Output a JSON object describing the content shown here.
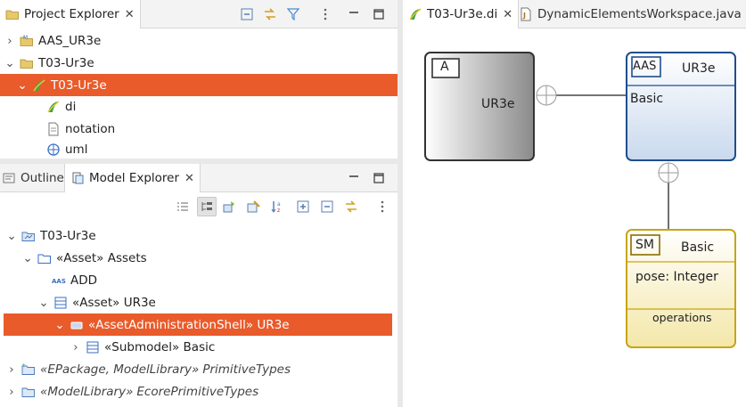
{
  "project_explorer": {
    "title": "Project Explorer",
    "items": [
      {
        "label": "AAS_UR3e"
      },
      {
        "label": "T03-Ur3e"
      },
      {
        "label": "T03-Ur3e"
      },
      {
        "label": "di"
      },
      {
        "label": "notation"
      },
      {
        "label": "uml"
      }
    ]
  },
  "bottom_tabs": {
    "outline": "Outline",
    "model_explorer": "Model Explorer"
  },
  "model_explorer": {
    "items": [
      {
        "label": "T03-Ur3e"
      },
      {
        "label": "«Asset» Assets"
      },
      {
        "label": "ADD"
      },
      {
        "label": "«Asset» UR3e"
      },
      {
        "label": "«AssetAdministrationShell» UR3e"
      },
      {
        "label": "«Submodel» Basic"
      },
      {
        "prefix": "«EPackage, ModelLibrary»",
        "label": "PrimitiveTypes"
      },
      {
        "prefix": "«ModelLibrary»",
        "label": "EcorePrimitiveTypes"
      }
    ]
  },
  "editor_tabs": {
    "diagram": "T03-Ur3e.di",
    "java": "DynamicElementsWorkspace.java"
  },
  "diagram": {
    "asset_box": {
      "badge": "A",
      "name": "UR3e"
    },
    "aas_box": {
      "badge": "AAS",
      "name": "UR3e",
      "compartment": "Basic"
    },
    "sm_box": {
      "badge": "SM",
      "name": "Basic",
      "attribute": "pose: Integer",
      "operations": "operations"
    }
  },
  "colors": {
    "selection": "#e95b2b",
    "aas_border": "#1f4e8c",
    "sm_border": "#c8a415"
  }
}
